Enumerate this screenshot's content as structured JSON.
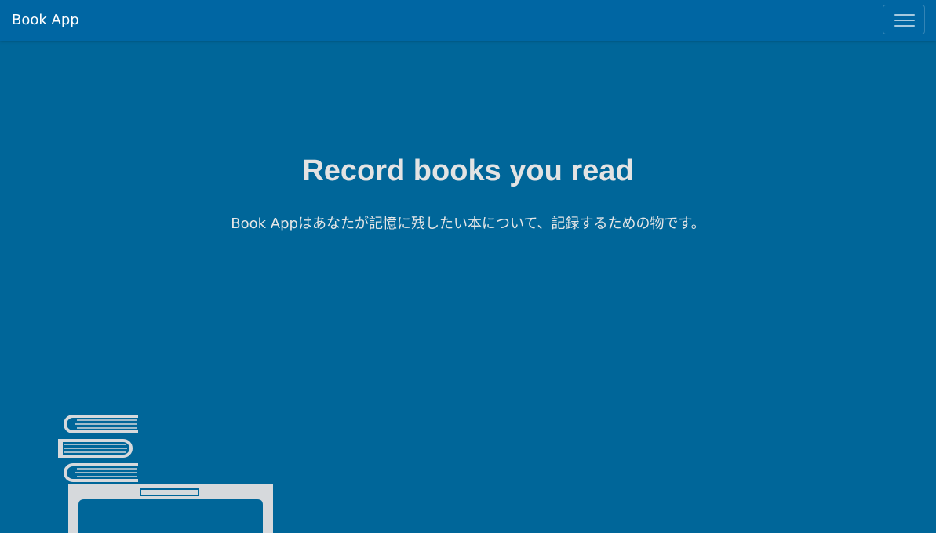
{
  "navbar": {
    "brand": "Book App",
    "toggle_icon": "hamburger-menu-icon"
  },
  "hero": {
    "title": "Record books you read",
    "lead": "Book Appはあなたが記憶に残したい本について、記録するための物です。",
    "illustration_icon": "book-stack-laptop-icon"
  },
  "colors": {
    "background": "#006699",
    "navbar": "#0066a3",
    "text": "#e3e3e3",
    "illustration": "#d6d9dc"
  }
}
